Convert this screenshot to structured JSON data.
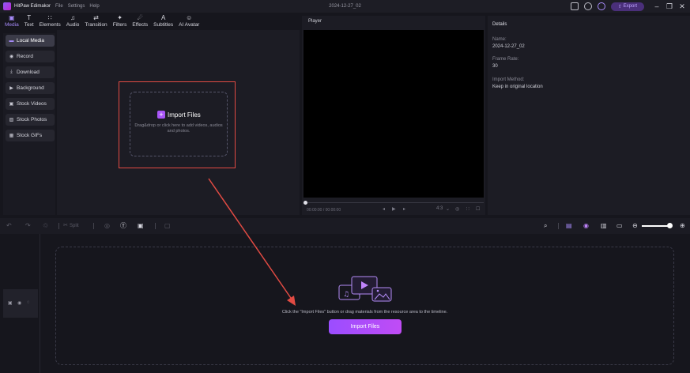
{
  "titlebar": {
    "app_name": "HitPaw Edimakor",
    "menus": [
      "File",
      "Settings",
      "Help"
    ],
    "doc_title": "2024-12-27_02",
    "export_label": "Export"
  },
  "toolbar": {
    "tools": [
      {
        "label": "Media",
        "icon": "▣",
        "active": true
      },
      {
        "label": "Text",
        "icon": "T",
        "active": false
      },
      {
        "label": "Elements",
        "icon": "∷",
        "active": false
      },
      {
        "label": "Audio",
        "icon": "♫",
        "active": false
      },
      {
        "label": "Transition",
        "icon": "⇄",
        "active": false
      },
      {
        "label": "Filters",
        "icon": "✦",
        "active": false
      },
      {
        "label": "Effects",
        "icon": "☄",
        "active": false
      },
      {
        "label": "Subtitles",
        "icon": "A",
        "active": false
      },
      {
        "label": "AI Avatar",
        "icon": "☺",
        "active": false
      }
    ]
  },
  "sidebar": {
    "items": [
      {
        "label": "Local Media",
        "icon": "▬",
        "active": true
      },
      {
        "label": "Record",
        "icon": "◉",
        "active": false
      },
      {
        "label": "Download",
        "icon": "⤓",
        "active": false
      },
      {
        "label": "Background",
        "icon": "▶",
        "active": false
      },
      {
        "label": "Stock Videos",
        "icon": "▣",
        "active": false
      },
      {
        "label": "Stock Photos",
        "icon": "▨",
        "active": false
      },
      {
        "label": "Stock GIFs",
        "icon": "▦",
        "active": false
      }
    ]
  },
  "media": {
    "import_label": "Import Files",
    "hint": "Drag&drop or click here to add videos, audios and photos."
  },
  "player": {
    "title": "Player",
    "time": "00:00:00 / 00:00:00",
    "ratio": "4:3"
  },
  "details": {
    "title": "Details",
    "name_label": "Name:",
    "name_value": "2024-12-27_02",
    "frame_rate_label": "Frame Rate:",
    "frame_rate_value": "30",
    "import_method_label": "Import Method:",
    "import_method_value": "Keep in original location"
  },
  "timeline_toolbar": {
    "split_label": "Split"
  },
  "timeline": {
    "message": "Click the \"Import Files\" button or drag materials from the resource area to the timeline.",
    "import_label": "Import Files"
  },
  "colors": {
    "accent": "#a855f7",
    "annotation": "#e24b43"
  }
}
